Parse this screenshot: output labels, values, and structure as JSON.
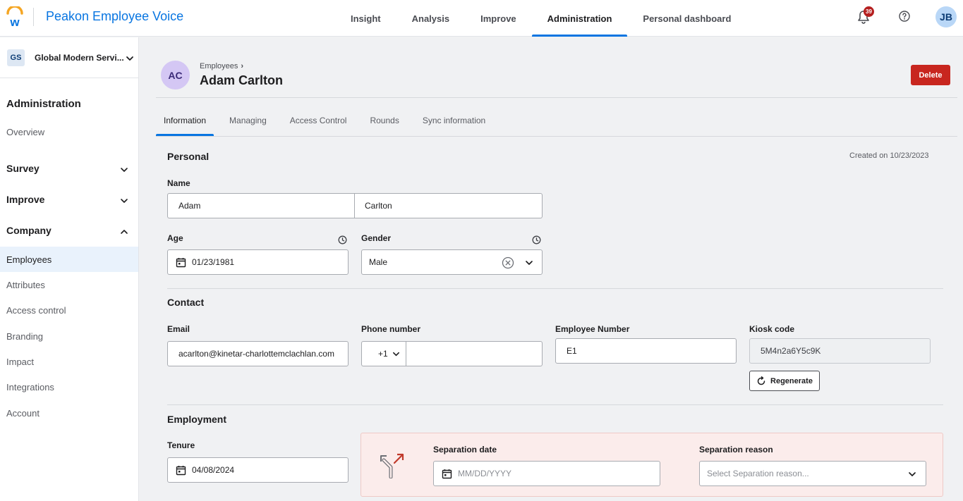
{
  "app": {
    "title": "Peakon Employee Voice"
  },
  "nav": [
    {
      "label": "Insight",
      "active": false
    },
    {
      "label": "Analysis",
      "active": false
    },
    {
      "label": "Improve",
      "active": false
    },
    {
      "label": "Administration",
      "active": true
    },
    {
      "label": "Personal dashboard",
      "active": false
    }
  ],
  "topbar": {
    "notification_count": "39",
    "user_initials": "JB"
  },
  "sidebar": {
    "org_initials": "GS",
    "org_name": "Global Modern Servi...",
    "admin_heading": "Administration",
    "overview": "Overview",
    "sections": {
      "survey": "Survey",
      "improve": "Improve",
      "company": "Company"
    },
    "company_items": [
      "Employees",
      "Attributes",
      "Access control",
      "Branding",
      "Impact",
      "Integrations",
      "Account"
    ],
    "active_item": "Employees"
  },
  "employee": {
    "initials": "AC",
    "breadcrumb": "Employees",
    "breadcrumb_sep": "›",
    "name": "Adam Carlton",
    "delete_label": "Delete"
  },
  "tabs": [
    "Information",
    "Managing",
    "Access Control",
    "Rounds",
    "Sync information"
  ],
  "personal": {
    "title": "Personal",
    "created": "Created on 10/23/2023",
    "name_label": "Name",
    "first_name": "Adam",
    "last_name": "Carlton",
    "age_label": "Age",
    "birth_date": "01/23/1981",
    "gender_label": "Gender",
    "gender": "Male"
  },
  "contact": {
    "title": "Contact",
    "email_label": "Email",
    "email": "acarlton@kinetar-charlottemclachlan.com",
    "phone_label": "Phone number",
    "phone_code": "+1",
    "phone": "",
    "employee_number_label": "Employee Number",
    "employee_number": "E1",
    "kiosk_label": "Kiosk code",
    "kiosk_code": "5M4n2a6Y5c9K",
    "regenerate_label": "Regenerate"
  },
  "employment": {
    "title": "Employment",
    "tenure_label": "Tenure",
    "tenure_date": "04/08/2024",
    "separation_date_label": "Separation date",
    "separation_date_placeholder": "MM/DD/YYYY",
    "separation_reason_label": "Separation reason",
    "separation_reason_placeholder": "Select Separation reason..."
  },
  "colors": {
    "brand_blue": "#0875e1",
    "delete_red": "#c8261f",
    "badge_red": "#b51f1f"
  },
  "icons": [
    "workday-logo-icon",
    "bell-icon",
    "help-icon",
    "chevron-down-icon",
    "chevron-up-icon",
    "clock-icon",
    "calendar-icon",
    "clear-icon",
    "regenerate-icon",
    "separation-arrow-icon"
  ]
}
